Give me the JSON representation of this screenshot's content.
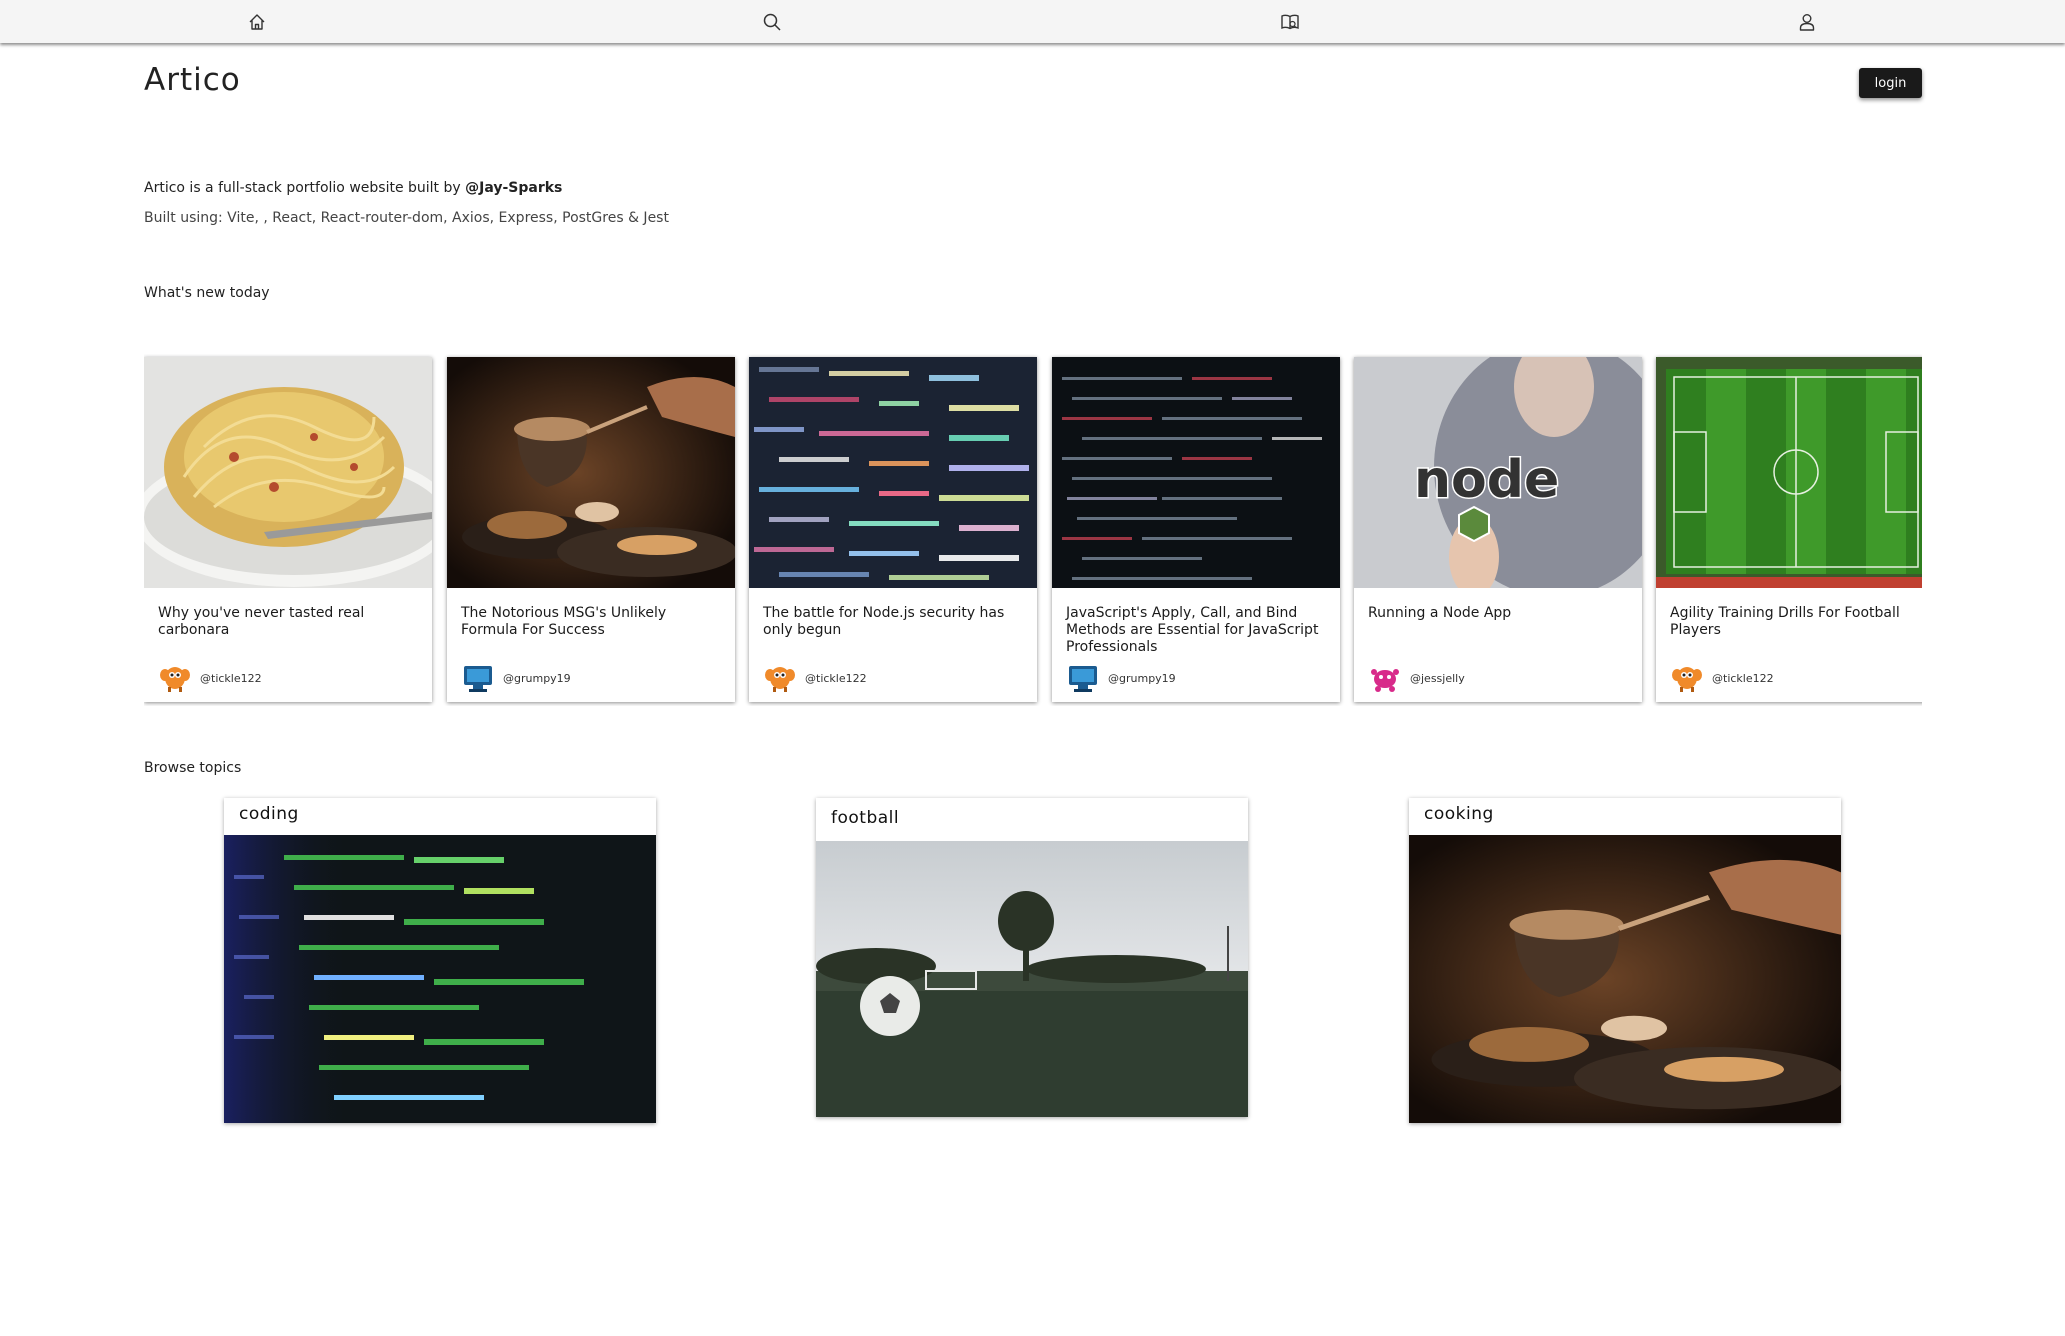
{
  "nav": {
    "items": [
      {
        "icon": "home-icon"
      },
      {
        "icon": "search-icon"
      },
      {
        "icon": "book-icon"
      },
      {
        "icon": "user-icon"
      }
    ]
  },
  "header": {
    "title": "Artico",
    "login_label": "login"
  },
  "intro": {
    "text": "Artico is a full-stack portfolio website built by ",
    "author": "@Jay-Sparks",
    "built_using": "Built using: Vite, , React, React-router-dom, Axios, Express, PostGres & Jest"
  },
  "whats_new": {
    "heading": "What's new today",
    "articles": [
      {
        "title": "Why you've never tasted real carbonara",
        "author": "@tickle122",
        "image": "pasta",
        "avatar": "orange-creature"
      },
      {
        "title": "The Notorious MSG's Unlikely Formula For Success",
        "author": "@grumpy19",
        "image": "cooking",
        "avatar": "blue-monitor"
      },
      {
        "title": "The battle for Node.js security has only begun",
        "author": "@tickle122",
        "image": "code-screen",
        "avatar": "orange-creature"
      },
      {
        "title": "JavaScript's Apply, Call, and Bind Methods are Essential for JavaScript Professionals",
        "author": "@grumpy19",
        "image": "code-dark",
        "avatar": "blue-monitor"
      },
      {
        "title": "Running a Node App",
        "author": "@jessjelly",
        "image": "node-sticker",
        "avatar": "pink-creature"
      },
      {
        "title": "Agility Training Drills For Football Players",
        "author": "@tickle122",
        "image": "football-pitch",
        "avatar": "orange-creature"
      }
    ]
  },
  "topics": {
    "heading": "Browse topics",
    "items": [
      {
        "label": "coding",
        "image": "code-green"
      },
      {
        "label": "football",
        "image": "ball-field"
      },
      {
        "label": "cooking",
        "image": "cooking"
      }
    ]
  },
  "colors": {
    "nav_bg": "#f5f5f5",
    "button_bg": "#1a1a1a",
    "text": "#1f1f1f"
  }
}
